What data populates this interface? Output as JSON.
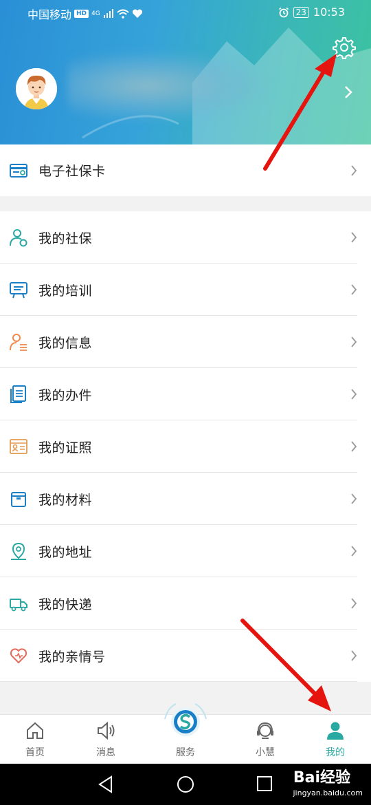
{
  "status_bar": {
    "carrier": "中国移动",
    "hd": "HD",
    "network": "4G",
    "battery": "23",
    "time": "10:53"
  },
  "header": {
    "settings_icon": "gear-icon",
    "avatar": "cartoon-boy-avatar"
  },
  "card": {
    "label": "电子社保卡",
    "icon": "social-security-card-icon"
  },
  "menu": [
    {
      "label": "我的社保",
      "icon": "person-shield-icon",
      "color": "#2aa9a2"
    },
    {
      "label": "我的培训",
      "icon": "training-board-icon",
      "color": "#1a7fc7"
    },
    {
      "label": "我的信息",
      "icon": "person-info-icon",
      "color": "#ef8a4a"
    },
    {
      "label": "我的办件",
      "icon": "documents-icon",
      "color": "#1a7fc7"
    },
    {
      "label": "我的证照",
      "icon": "license-card-icon",
      "color": "#e29a4e"
    },
    {
      "label": "我的材料",
      "icon": "folder-icon",
      "color": "#1a7fc7"
    },
    {
      "label": "我的地址",
      "icon": "location-pin-icon",
      "color": "#2aa9a2"
    },
    {
      "label": "我的快递",
      "icon": "delivery-truck-icon",
      "color": "#2aa9a2"
    },
    {
      "label": "我的亲情号",
      "icon": "heart-chat-icon",
      "color": "#e46a5a"
    }
  ],
  "bottom_nav": {
    "home": "首页",
    "messages": "消息",
    "service": "服务",
    "assistant": "小慧",
    "mine": "我的"
  },
  "watermark": {
    "brand": "Bai经验",
    "url": "jingyan.baidu.com"
  },
  "colors": {
    "accent": "#2aa9a2",
    "header_start": "#2a8fd6",
    "header_end": "#3cc39f",
    "annotation_arrow": "#e5140f"
  }
}
